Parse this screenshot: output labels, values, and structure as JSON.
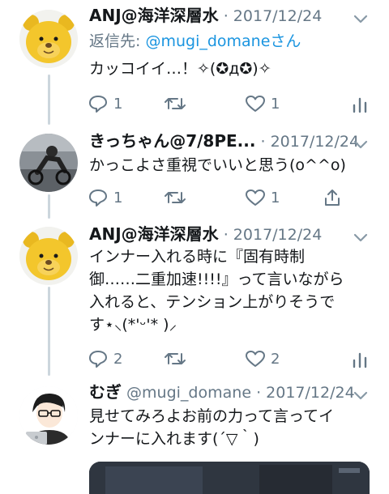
{
  "tweets": [
    {
      "name": "ANJ@海洋深層水",
      "handle": "",
      "date": "· 2017/12/24",
      "reply_prefix": "返信先: ",
      "reply_handle": "@mugi_domaneさん",
      "text_lines": [
        "カッコイイ…！✧(✪д✪)✧"
      ],
      "reply_count": "1",
      "retweet_count": "",
      "like_count": "1",
      "last_action_icon": "analytics-icon"
    },
    {
      "name": "きっちゃん@7/8PE...",
      "handle": "",
      "date": "· 2017/12/24",
      "text_lines": [
        "かっこよさ重視でいいと思う(o^^o)"
      ],
      "reply_count": "1",
      "retweet_count": "",
      "like_count": "1",
      "last_action_icon": "share-icon"
    },
    {
      "name": "ANJ@海洋深層水",
      "handle": "",
      "date": "· 2017/12/24",
      "text_lines": [
        "インナー入れる時に『固有時制",
        "御……二重加速!!!!』って言いながら",
        "入れると、テンション上がりそうで",
        "す⋆⸜(*'ᵕ'* )⸝"
      ],
      "reply_count": "2",
      "retweet_count": "",
      "like_count": "2",
      "last_action_icon": "analytics-icon"
    },
    {
      "name": "むぎ",
      "handle": "@mugi_domane",
      "date": "· 2017/12/24",
      "text_lines": [
        "見せてみろよお前の力って言ってイ",
        "ンナーに入れます(´▽｀)"
      ]
    }
  ],
  "colors": {
    "text": "#14171a",
    "secondary": "#657786",
    "link": "#1b95e0",
    "thread_line": "#ccd6dd"
  }
}
